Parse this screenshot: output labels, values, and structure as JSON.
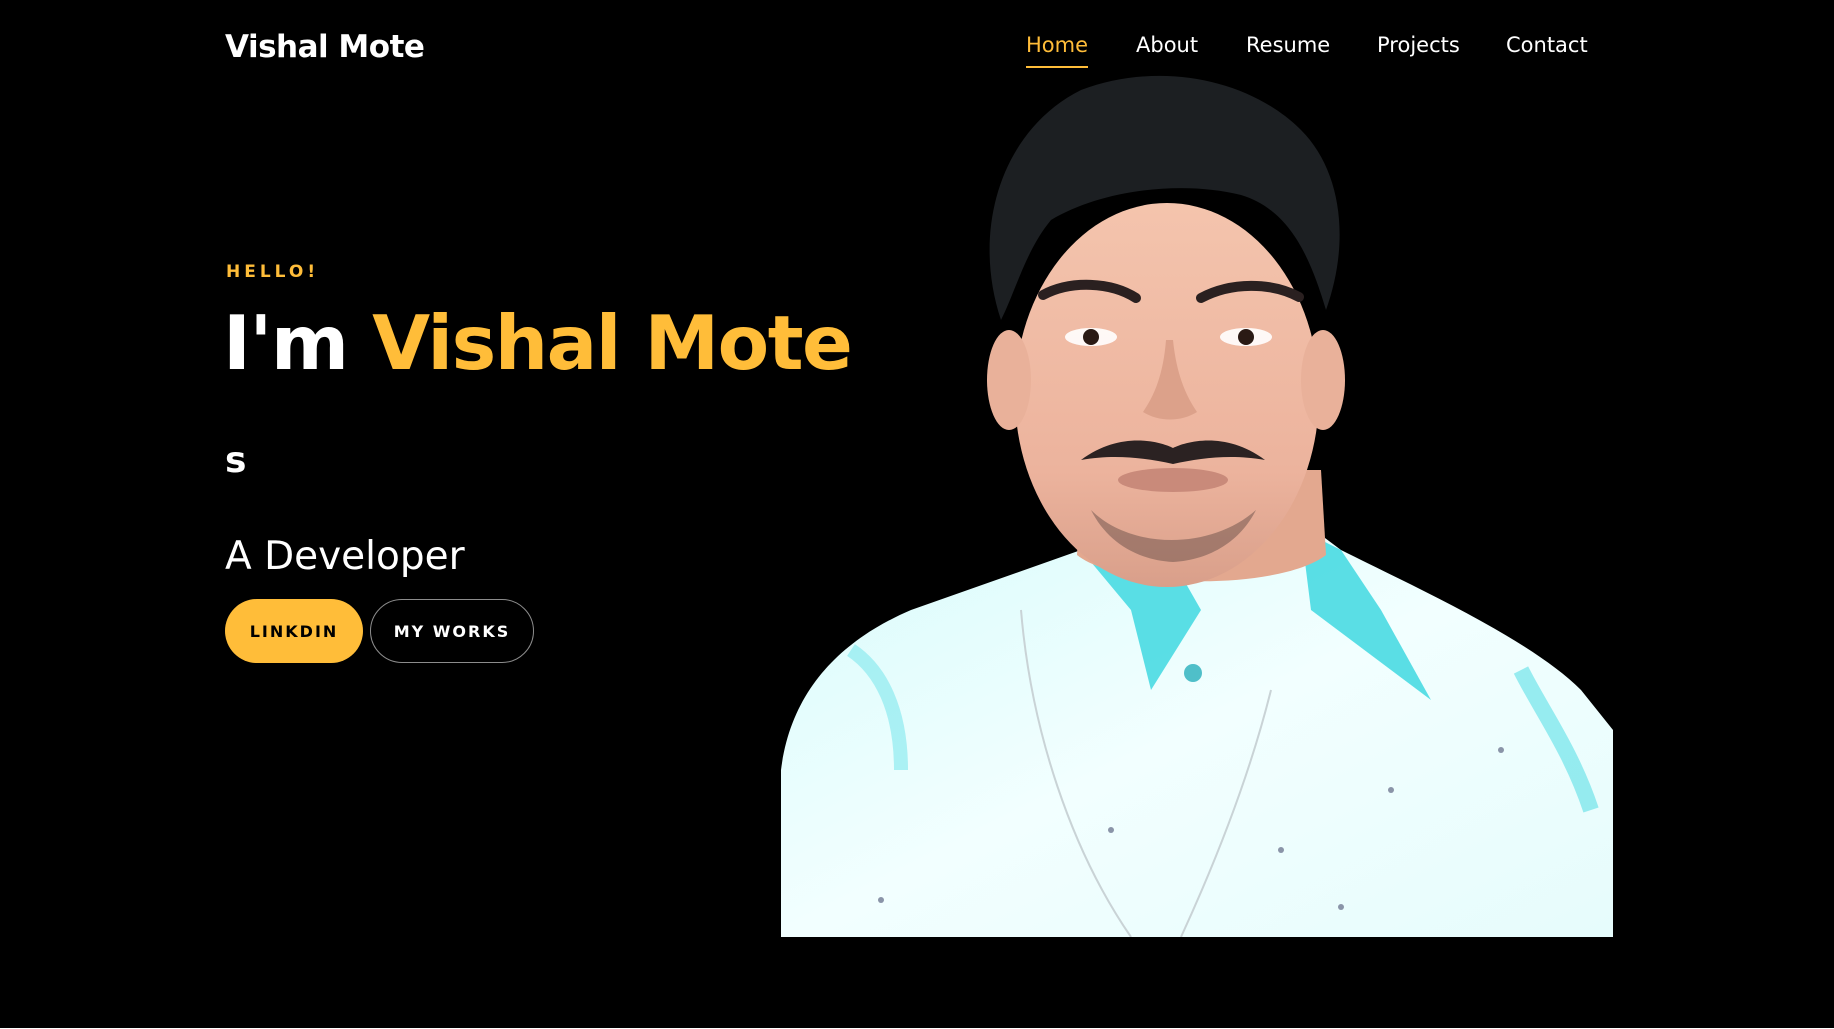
{
  "header": {
    "brand": "Vishal Mote",
    "nav": [
      {
        "label": "Home",
        "active": true
      },
      {
        "label": "About",
        "active": false
      },
      {
        "label": "Resume",
        "active": false
      },
      {
        "label": "Projects",
        "active": false
      },
      {
        "label": "Contact",
        "active": false
      }
    ]
  },
  "hero": {
    "greeting": "HELLO!",
    "headline_prefix": "I'm ",
    "headline_name": "Vishal Mote",
    "typed_text": "s",
    "role": "A Developer",
    "buttons": {
      "primary": "LINKDIN",
      "secondary": "MY WORKS"
    }
  },
  "colors": {
    "background": "#000000",
    "accent": "#ffbd39",
    "text": "#ffffff"
  }
}
